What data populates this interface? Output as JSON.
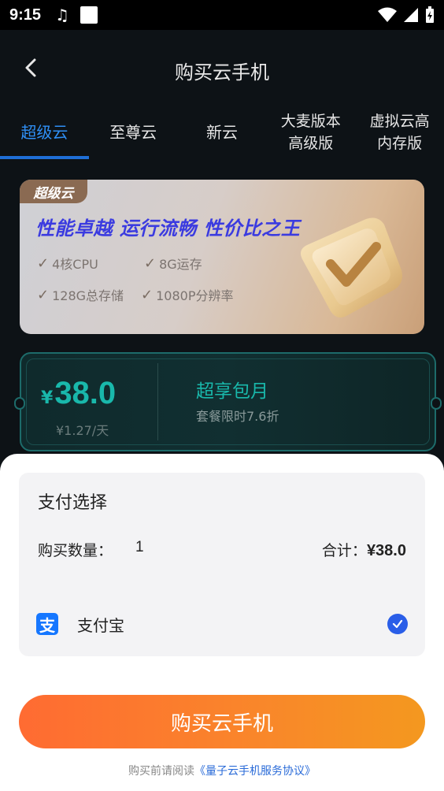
{
  "status_bar": {
    "time": "9:15"
  },
  "header": {
    "title": "购买云手机"
  },
  "tabs": [
    {
      "label": "超级云",
      "active": true
    },
    {
      "label": "至尊云",
      "active": false
    },
    {
      "label": "新云",
      "active": false
    },
    {
      "label": "大麦版本\n高级版",
      "active": false
    },
    {
      "label": "虚拟云高\n内存版",
      "active": false
    }
  ],
  "banner": {
    "tag": "超级云",
    "headline": "性能卓越 运行流畅 性价比之王",
    "features": [
      "4核CPU",
      "8G运存",
      "128G总存储",
      "1080P分辨率"
    ]
  },
  "price_card": {
    "currency": "¥",
    "price": "38.0",
    "daily": "¥1.27/天",
    "plan_name": "超享包月",
    "plan_sub": "套餐限时7.6折"
  },
  "payment": {
    "title": "支付选择",
    "qty_label": "购买数量：",
    "qty_value": "1",
    "total_label": "合计：",
    "total_amount": "¥38.0",
    "method": "支付宝",
    "method_icon": "支"
  },
  "buy_button": "购买云手机",
  "agreement": {
    "prefix": "购买前请阅读",
    "link": "《量子云手机服务协议》"
  },
  "colors": {
    "accent_blue": "#2f8ff5",
    "teal": "#19b8ab",
    "orange_start": "#ff6b32",
    "orange_end": "#f4981f"
  }
}
